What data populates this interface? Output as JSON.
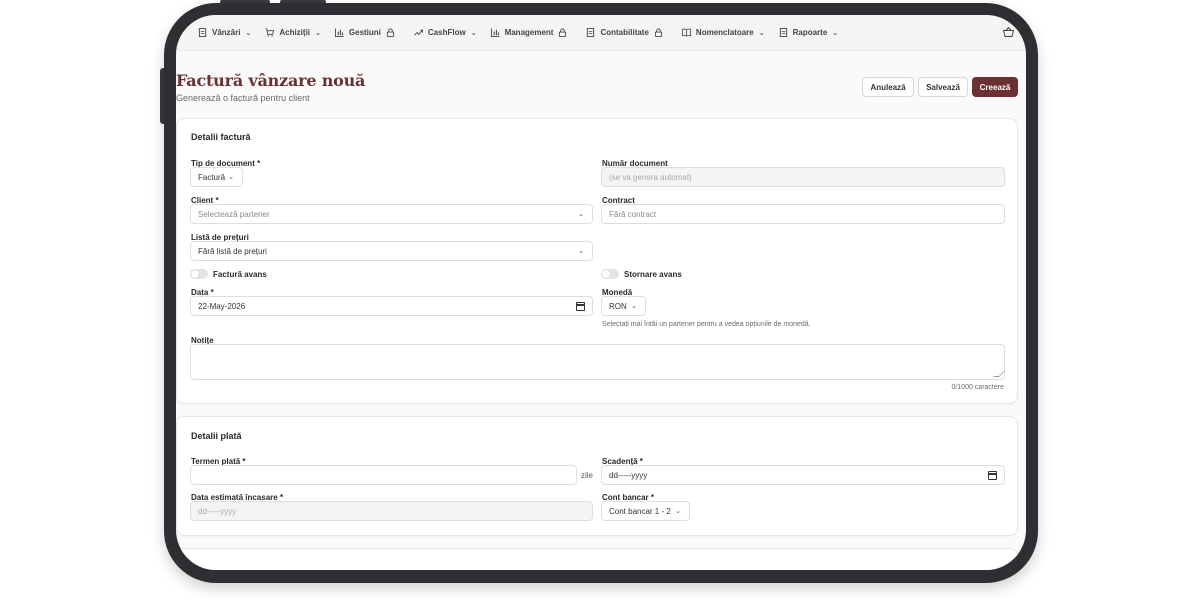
{
  "nav": {
    "items": [
      {
        "label": "Vânzări",
        "icon": "document-icon",
        "has_chevron": true,
        "locked": false
      },
      {
        "label": "Achiziții",
        "icon": "cart-icon",
        "has_chevron": true,
        "locked": false
      },
      {
        "label": "Gestiuni",
        "icon": "bar-chart-icon",
        "has_chevron": false,
        "locked": true
      },
      {
        "label": "CashFlow",
        "icon": "trend-icon",
        "has_chevron": true,
        "locked": false
      },
      {
        "label": "Management",
        "icon": "bar-chart-icon",
        "has_chevron": false,
        "locked": true
      },
      {
        "label": "Contabilitate",
        "icon": "document-icon",
        "has_chevron": false,
        "locked": true
      },
      {
        "label": "Nomenclatoare",
        "icon": "book-icon",
        "has_chevron": true,
        "locked": false
      },
      {
        "label": "Rapoarte",
        "icon": "document-icon",
        "has_chevron": true,
        "locked": false
      }
    ]
  },
  "header": {
    "title": "Factură vânzare nouă",
    "subtitle": "Generează o factură pentru client",
    "cancel_label": "Anulează",
    "save_label": "Salvează",
    "create_label": "Creează"
  },
  "invoice_details": {
    "section_title": "Detalii factură",
    "doc_type_label": "Tip de document *",
    "doc_type_value": "Factură",
    "doc_number_label": "Număr document",
    "doc_number_placeholder": "(se va genera automat)",
    "client_label": "Client *",
    "client_placeholder": "Selectează partener",
    "contract_label": "Contract",
    "contract_placeholder": "Fără contract",
    "price_list_label": "Listă de prețuri",
    "price_list_value": "Fără listă de prețuri",
    "advance_invoice_label": "Factură avans",
    "advance_reversal_label": "Stornare avans",
    "date_label": "Data *",
    "date_value": "22-May-2026",
    "currency_label": "Monedă",
    "currency_value": "RON",
    "currency_hint": "Selectați mai întâi un partener pentru a vedea opțiunile de monedă.",
    "notes_label": "Notițe",
    "notes_counter": "0/1000 caractere"
  },
  "payment_details": {
    "section_title": "Detalii plată",
    "payment_term_label": "Termen plată *",
    "payment_term_suffix": "zile",
    "due_date_label": "Scadență *",
    "due_date_placeholder": "dd-----yyyy",
    "estimated_date_label": "Data estimată încasare *",
    "estimated_date_placeholder": "dd-----yyyy",
    "bank_account_label": "Cont bancar *",
    "bank_account_value": "Cont bancar 1 - 2"
  },
  "colors": {
    "brand": "#6b3030",
    "device_frame": "#2f2f33"
  }
}
